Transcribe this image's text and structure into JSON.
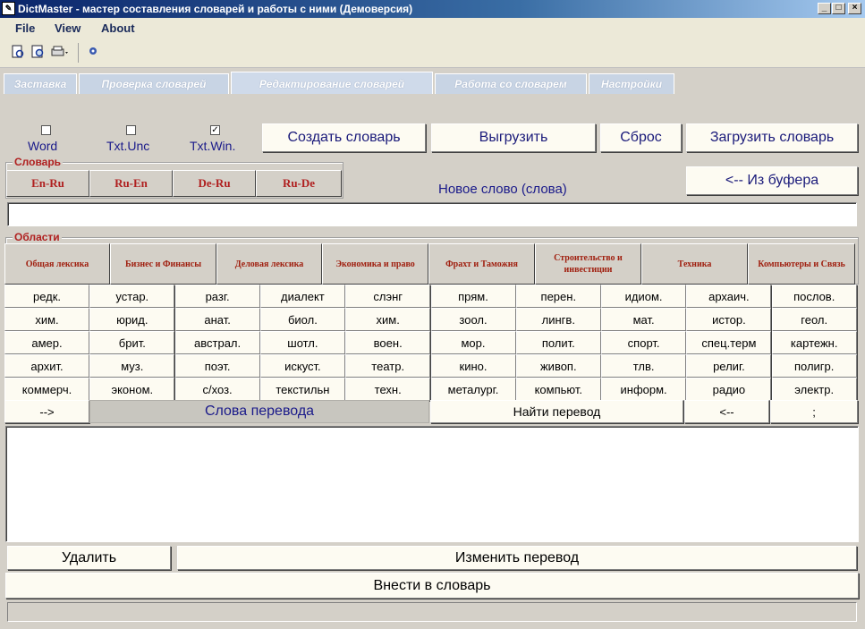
{
  "window": {
    "title": "DictMaster - мастер составления словарей и работы с ними (Демоверсия)",
    "controls": [
      "_",
      "□",
      "×"
    ]
  },
  "menu": [
    "File",
    "View",
    "About"
  ],
  "tabs": [
    {
      "label": "Заставка"
    },
    {
      "label": "Проверка словарей"
    },
    {
      "label": "Редактирование словарей"
    },
    {
      "label": "Работа со словарем"
    },
    {
      "label": "Настройки"
    }
  ],
  "formats": [
    {
      "label": "Word",
      "checked": false
    },
    {
      "label": "Txt.Unc",
      "checked": false
    },
    {
      "label": "Txt.Win.",
      "checked": true
    }
  ],
  "actions": {
    "create": "Создать словарь",
    "export": "Выгрузить",
    "reset": "Сброс",
    "load": "Загрузить словарь",
    "from_buffer": "<-- Из буфера"
  },
  "dictionary_group": {
    "label": "Словарь",
    "languages": [
      "En-Ru",
      "Ru-En",
      "De-Ru",
      "Ru-De"
    ]
  },
  "new_word_label": "Новое слово (слова)",
  "new_word_value": "",
  "areas_group": {
    "label": "Области",
    "areas": [
      "Общая лексика",
      "Бизнес и Финансы",
      "Деловая лексика",
      "Экономика и право",
      "Фрахт и Таможня",
      "Строительство и инвестиции",
      "Техника",
      "Компьютеры и Связь"
    ]
  },
  "subject_tags": [
    [
      "редк.",
      "устар.",
      "разг.",
      "диалект",
      "слэнг",
      "прям.",
      "перен.",
      "идиом.",
      "архаич.",
      "послов."
    ],
    [
      "хим.",
      "юрид.",
      "анат.",
      "биол.",
      "хим.",
      "зоол.",
      "лингв.",
      "мат.",
      "истор.",
      "геол."
    ],
    [
      "амер.",
      "брит.",
      "австрал.",
      "шотл.",
      "воен.",
      "мор.",
      "полит.",
      "спорт.",
      "спец.терм",
      "картежн."
    ],
    [
      "архит.",
      "муз.",
      "поэт.",
      "искуст.",
      "театр.",
      "кино.",
      "живоп.",
      "тлв.",
      "религ.",
      "полигр."
    ],
    [
      "коммерч.",
      "эконом.",
      "с/хоз.",
      "текстильн",
      "техн.",
      "металург.",
      "компьют.",
      "информ.",
      "радио",
      "электр."
    ]
  ],
  "translation": {
    "arrow_right": "-->",
    "words_label": "Слова перевода",
    "find": "Найти перевод",
    "arrow_left": "<--",
    "separator": ";",
    "text": ""
  },
  "bottom": {
    "delete": "Удалить",
    "change": "Изменить перевод",
    "add": "Внести в словарь",
    "status": ""
  },
  "icons": [
    "new-document-icon",
    "preview-icon",
    "print-icon",
    "settings-icon"
  ]
}
